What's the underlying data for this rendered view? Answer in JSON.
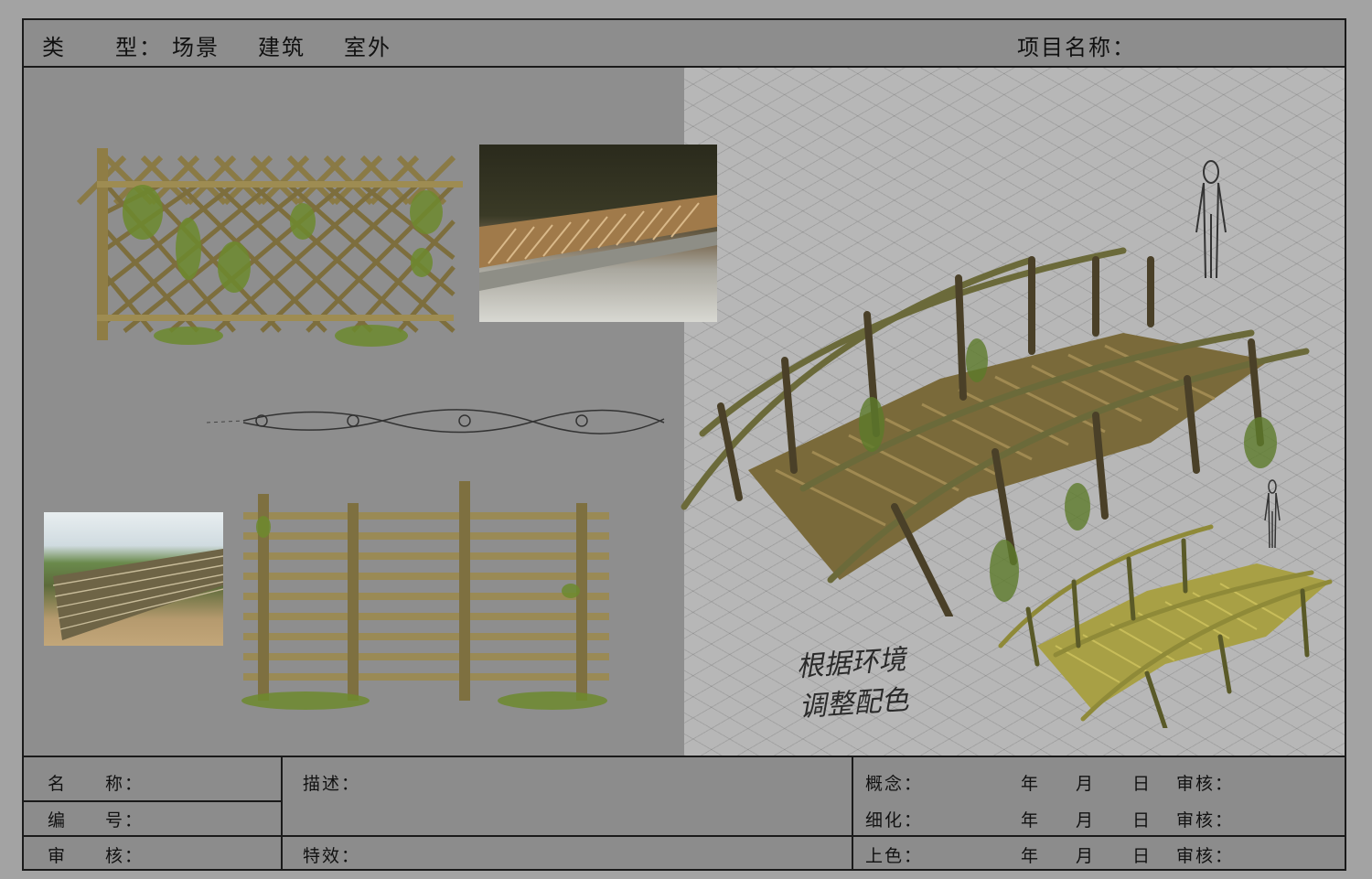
{
  "header": {
    "type_label": "类",
    "type_label2": "型：",
    "type_values": [
      "场景",
      "建筑",
      "室外"
    ],
    "project_label": "项目名称："
  },
  "sketch_note": "根据环境\n调整配色",
  "footer": {
    "name_label": "名　　称：",
    "number_label": "编　　号：",
    "review_label": "审　　核：",
    "desc_label": "描述：",
    "fx_label": "特效：",
    "rows": [
      {
        "stage": "概念：",
        "year": "年",
        "month": "月",
        "day": "日",
        "review": "审核："
      },
      {
        "stage": "细化：",
        "year": "年",
        "month": "月",
        "day": "日",
        "review": "审核："
      },
      {
        "stage": "上色：",
        "year": "年",
        "month": "月",
        "day": "日",
        "review": "审核："
      }
    ]
  },
  "colors": {
    "sheet_bg": "#8c8c8c",
    "grid_bg": "#b7b7b7",
    "bamboo": "#9a8a55",
    "bamboo_dark": "#4a3f25",
    "moss": "#6d8a2e"
  }
}
